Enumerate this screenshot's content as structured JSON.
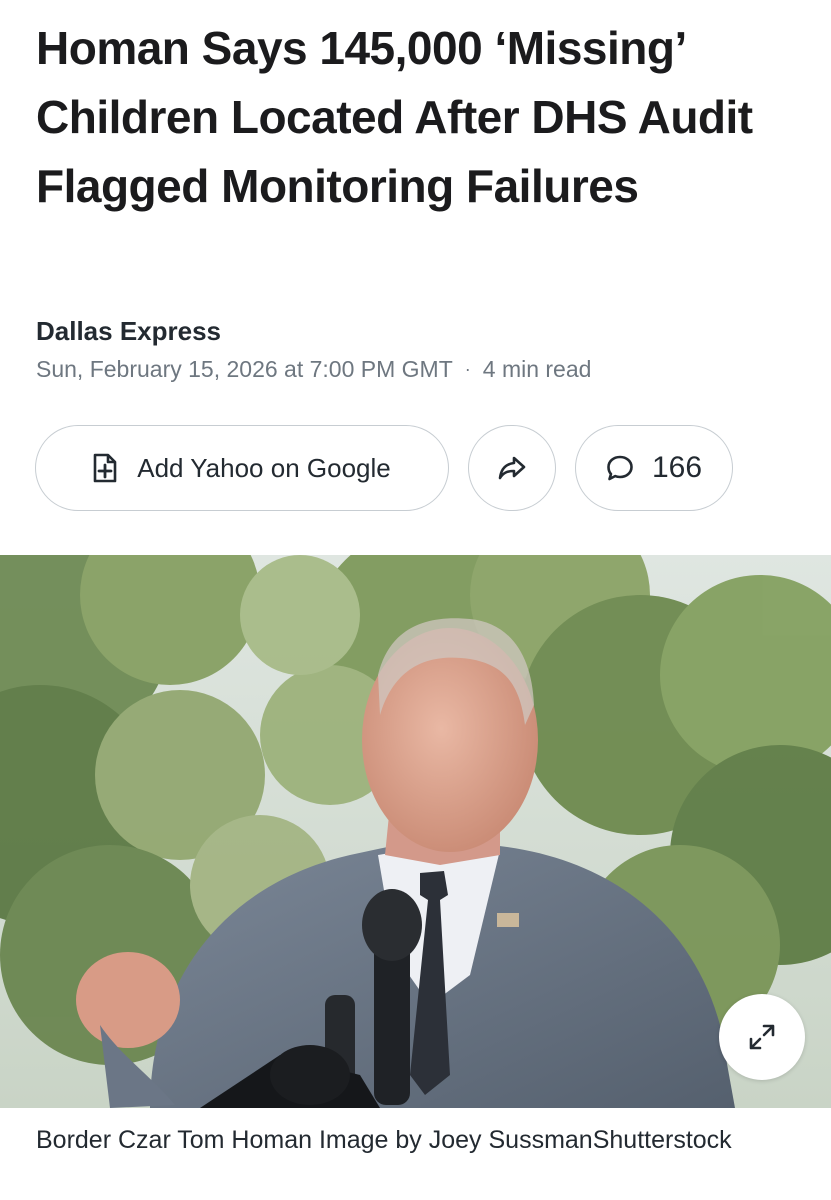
{
  "article": {
    "headline": "Homan Says 145,000 ‘Missing’ Children Located After DHS Audit Flagged Monitoring Failures",
    "source": "Dallas Express",
    "date": "Sun, February 15, 2026 at 7:00 PM GMT",
    "separator": "·",
    "read_time": "4 min read"
  },
  "actions": {
    "add_google_label": "Add Yahoo on Google",
    "add_google_icon": "add-document-icon",
    "share_icon": "share-arrow-icon",
    "comments_icon": "speech-bubble-icon",
    "comments_count": "166"
  },
  "photo": {
    "expand_icon": "expand-arrows-icon",
    "caption": "Border Czar Tom Homan Image by Joey SussmanShutterstock"
  },
  "colors": {
    "text": "#1b1b1d",
    "meta": "#6e7780",
    "pill_border": "#c7cdd2"
  }
}
